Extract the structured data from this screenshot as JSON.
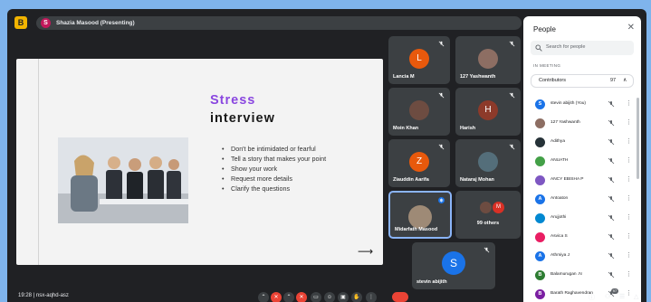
{
  "topbar": {
    "logo_glyph": "B",
    "presenter_initial": "S",
    "presenter_label": "Shazia Masood (Presenting)"
  },
  "slide": {
    "title_line1": "Stress",
    "title_line2": "interview",
    "bullets": [
      "Don't be intimidated or fearful",
      "Tell a story that makes your point",
      "Show your work",
      "Request more details",
      "Clarify the questions"
    ],
    "arrow_glyph": "⟶",
    "title_color": "#8a47e0"
  },
  "tiles": [
    {
      "name": "Lancia M",
      "initial": "L",
      "color": "#e8590c"
    },
    {
      "name": "127 Yashwanth",
      "initial": "",
      "color": "#8d6e63"
    },
    {
      "name": "Moin Khan",
      "initial": "",
      "color": "#6d4c41"
    },
    {
      "name": "Harish",
      "initial": "H",
      "color": "#8d3a2a"
    },
    {
      "name": "Ziauddin Aarifa",
      "initial": "Z",
      "color": "#e8590c"
    },
    {
      "name": "Nataraj Mohan",
      "initial": "",
      "color": "#546e7a"
    },
    {
      "name": "Midarfath Masood",
      "initial": "",
      "color": "#9e8a76"
    },
    {
      "name": "99 others",
      "initial": "M",
      "color": "#d93025"
    },
    {
      "name": "stevin abijith",
      "initial": "S",
      "color": "#1a73e8"
    }
  ],
  "panel": {
    "title": "People",
    "close_glyph": "✕",
    "search_placeholder": "Search for people",
    "section_label": "IN MEETING",
    "contributors_label": "Contributors",
    "contributors_count": "97",
    "chevron_glyph": "∧",
    "more_glyph": "⋮",
    "people": [
      {
        "name": "stevin abijith (You)",
        "initial": "S",
        "color": "#1a73e8"
      },
      {
        "name": "127 Yashwanth",
        "initial": "",
        "color": "#8d6e63"
      },
      {
        "name": "Adithya",
        "initial": "",
        "color": "#263238"
      },
      {
        "name": "ANUATH",
        "initial": "",
        "color": "#43a047"
      },
      {
        "name": "ANCY EBISHA P",
        "initial": "",
        "color": "#7e57c2"
      },
      {
        "name": "Antoaton",
        "initial": "A",
        "color": "#1a73e8"
      },
      {
        "name": "Arujjothi",
        "initial": "",
        "color": "#0288d1"
      },
      {
        "name": "Asvica S",
        "initial": "",
        "color": "#e91e63"
      },
      {
        "name": "Athmiya J",
        "initial": "A",
        "color": "#1a73e8"
      },
      {
        "name": "Balamurugan .N",
        "initial": "B",
        "color": "#2e7d32"
      },
      {
        "name": "Barath Raghavendran",
        "initial": "B",
        "color": "#7b1fa2"
      }
    ]
  },
  "bottombar": {
    "clock_text": "19:28  |  nsx-aqhd-asz",
    "badge_count": "97"
  }
}
